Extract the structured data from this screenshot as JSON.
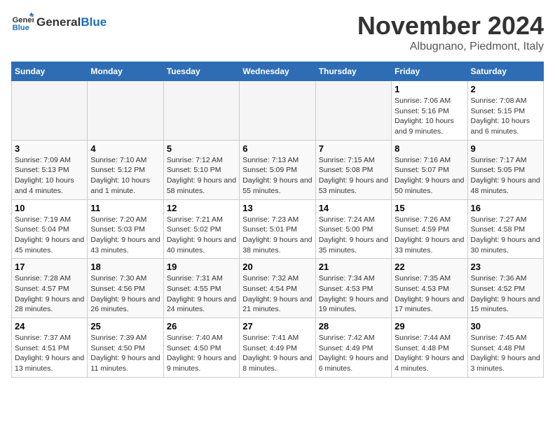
{
  "header": {
    "logo_text_general": "General",
    "logo_text_blue": "Blue",
    "month": "November 2024",
    "location": "Albugnano, Piedmont, Italy"
  },
  "weekdays": [
    "Sunday",
    "Monday",
    "Tuesday",
    "Wednesday",
    "Thursday",
    "Friday",
    "Saturday"
  ],
  "weeks": [
    [
      {
        "day": "",
        "info": ""
      },
      {
        "day": "",
        "info": ""
      },
      {
        "day": "",
        "info": ""
      },
      {
        "day": "",
        "info": ""
      },
      {
        "day": "",
        "info": ""
      },
      {
        "day": "1",
        "info": "Sunrise: 7:06 AM\nSunset: 5:16 PM\nDaylight: 10 hours and 9 minutes."
      },
      {
        "day": "2",
        "info": "Sunrise: 7:08 AM\nSunset: 5:15 PM\nDaylight: 10 hours and 6 minutes."
      }
    ],
    [
      {
        "day": "3",
        "info": "Sunrise: 7:09 AM\nSunset: 5:13 PM\nDaylight: 10 hours and 4 minutes."
      },
      {
        "day": "4",
        "info": "Sunrise: 7:10 AM\nSunset: 5:12 PM\nDaylight: 10 hours and 1 minute."
      },
      {
        "day": "5",
        "info": "Sunrise: 7:12 AM\nSunset: 5:10 PM\nDaylight: 9 hours and 58 minutes."
      },
      {
        "day": "6",
        "info": "Sunrise: 7:13 AM\nSunset: 5:09 PM\nDaylight: 9 hours and 55 minutes."
      },
      {
        "day": "7",
        "info": "Sunrise: 7:15 AM\nSunset: 5:08 PM\nDaylight: 9 hours and 53 minutes."
      },
      {
        "day": "8",
        "info": "Sunrise: 7:16 AM\nSunset: 5:07 PM\nDaylight: 9 hours and 50 minutes."
      },
      {
        "day": "9",
        "info": "Sunrise: 7:17 AM\nSunset: 5:05 PM\nDaylight: 9 hours and 48 minutes."
      }
    ],
    [
      {
        "day": "10",
        "info": "Sunrise: 7:19 AM\nSunset: 5:04 PM\nDaylight: 9 hours and 45 minutes."
      },
      {
        "day": "11",
        "info": "Sunrise: 7:20 AM\nSunset: 5:03 PM\nDaylight: 9 hours and 43 minutes."
      },
      {
        "day": "12",
        "info": "Sunrise: 7:21 AM\nSunset: 5:02 PM\nDaylight: 9 hours and 40 minutes."
      },
      {
        "day": "13",
        "info": "Sunrise: 7:23 AM\nSunset: 5:01 PM\nDaylight: 9 hours and 38 minutes."
      },
      {
        "day": "14",
        "info": "Sunrise: 7:24 AM\nSunset: 5:00 PM\nDaylight: 9 hours and 35 minutes."
      },
      {
        "day": "15",
        "info": "Sunrise: 7:26 AM\nSunset: 4:59 PM\nDaylight: 9 hours and 33 minutes."
      },
      {
        "day": "16",
        "info": "Sunrise: 7:27 AM\nSunset: 4:58 PM\nDaylight: 9 hours and 30 minutes."
      }
    ],
    [
      {
        "day": "17",
        "info": "Sunrise: 7:28 AM\nSunset: 4:57 PM\nDaylight: 9 hours and 28 minutes."
      },
      {
        "day": "18",
        "info": "Sunrise: 7:30 AM\nSunset: 4:56 PM\nDaylight: 9 hours and 26 minutes."
      },
      {
        "day": "19",
        "info": "Sunrise: 7:31 AM\nSunset: 4:55 PM\nDaylight: 9 hours and 24 minutes."
      },
      {
        "day": "20",
        "info": "Sunrise: 7:32 AM\nSunset: 4:54 PM\nDaylight: 9 hours and 21 minutes."
      },
      {
        "day": "21",
        "info": "Sunrise: 7:34 AM\nSunset: 4:53 PM\nDaylight: 9 hours and 19 minutes."
      },
      {
        "day": "22",
        "info": "Sunrise: 7:35 AM\nSunset: 4:53 PM\nDaylight: 9 hours and 17 minutes."
      },
      {
        "day": "23",
        "info": "Sunrise: 7:36 AM\nSunset: 4:52 PM\nDaylight: 9 hours and 15 minutes."
      }
    ],
    [
      {
        "day": "24",
        "info": "Sunrise: 7:37 AM\nSunset: 4:51 PM\nDaylight: 9 hours and 13 minutes."
      },
      {
        "day": "25",
        "info": "Sunrise: 7:39 AM\nSunset: 4:50 PM\nDaylight: 9 hours and 11 minutes."
      },
      {
        "day": "26",
        "info": "Sunrise: 7:40 AM\nSunset: 4:50 PM\nDaylight: 9 hours and 9 minutes."
      },
      {
        "day": "27",
        "info": "Sunrise: 7:41 AM\nSunset: 4:49 PM\nDaylight: 9 hours and 8 minutes."
      },
      {
        "day": "28",
        "info": "Sunrise: 7:42 AM\nSunset: 4:49 PM\nDaylight: 9 hours and 6 minutes."
      },
      {
        "day": "29",
        "info": "Sunrise: 7:44 AM\nSunset: 4:48 PM\nDaylight: 9 hours and 4 minutes."
      },
      {
        "day": "30",
        "info": "Sunrise: 7:45 AM\nSunset: 4:48 PM\nDaylight: 9 hours and 3 minutes."
      }
    ]
  ]
}
